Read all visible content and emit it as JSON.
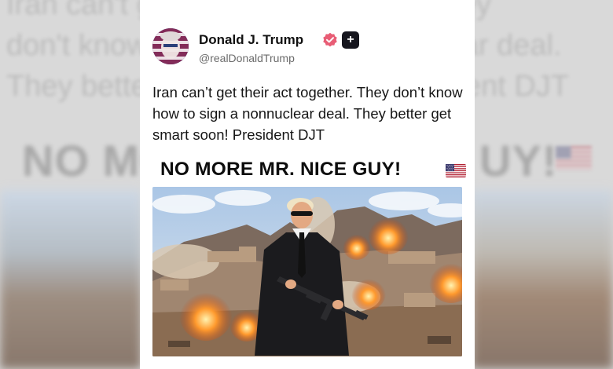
{
  "post": {
    "author_name": "Donald J. Trump",
    "author_handle": "@realDonaldTrump",
    "text": "Iran can’t get their act together. They don’t know how to sign a nonnuclear deal. They better get smart soon! President DJT",
    "headline": "NO MORE MR. NICE GUY!"
  },
  "background": {
    "echo_text": "Iran can't get their act together. They\ndon't know how to sign a nonnuclear deal.\nThey better get smart soon! President DJT",
    "headline_left": "NO MO",
    "headline_right": "UY!"
  },
  "icons": {
    "verified": "verified-badge-icon",
    "plus": "plus-icon",
    "flag": "us-flag-icon"
  },
  "colors": {
    "verified_badge": "#e85d75",
    "plus_badge": "#16161e",
    "card_bg": "#ffffff",
    "text": "#161616",
    "handle": "#6b6b6b"
  }
}
